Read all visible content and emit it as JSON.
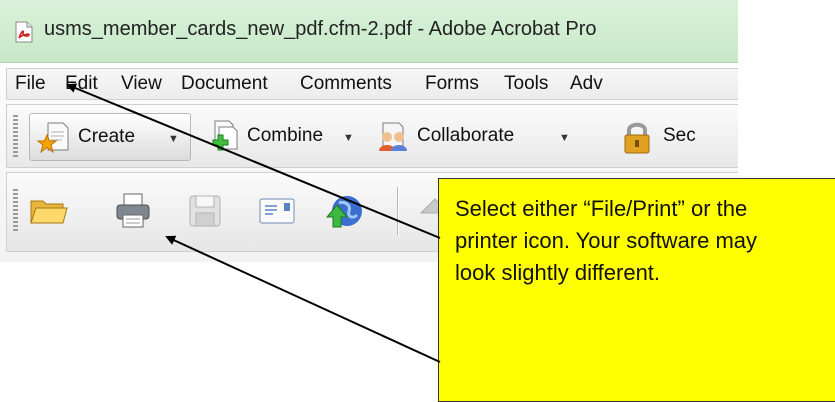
{
  "window": {
    "title": "usms_member_cards_new_pdf.cfm-2.pdf - Adobe Acrobat Pro"
  },
  "menubar": {
    "items": [
      "File",
      "Edit",
      "View",
      "Document",
      "Comments",
      "Forms",
      "Tools",
      "Adv"
    ]
  },
  "toolbar": {
    "create_label": "Create",
    "combine_label": "Combine",
    "collaborate_label": "Collaborate",
    "secure_label": "Sec"
  },
  "file_toolbar": {
    "icons": [
      "open-folder-icon",
      "print-icon",
      "save-icon",
      "email-icon",
      "upload-icon"
    ]
  },
  "callout": {
    "text": "Select either “File/Print” or the printer icon.  Your software may look slightly different."
  },
  "colors": {
    "titlebar": "#d0eed0",
    "callout_fill": "#ffff00",
    "pdf_red": "#cc1f1f"
  }
}
